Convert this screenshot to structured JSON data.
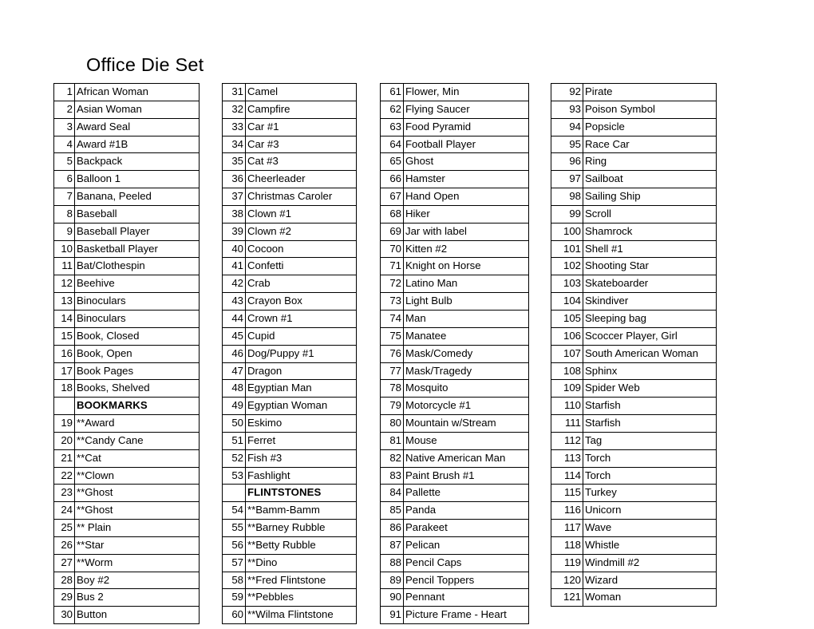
{
  "document": {
    "title": "Office Die Set"
  },
  "columns": [
    {
      "id": "column-1",
      "rows": [
        {
          "num": "1",
          "label": "African Woman",
          "section": false
        },
        {
          "num": "2",
          "label": "Asian Woman",
          "section": false
        },
        {
          "num": "3",
          "label": "Award Seal",
          "section": false
        },
        {
          "num": "4",
          "label": "Award #1B",
          "section": false
        },
        {
          "num": "5",
          "label": "Backpack",
          "section": false
        },
        {
          "num": "6",
          "label": "Balloon 1",
          "section": false
        },
        {
          "num": "7",
          "label": "Banana, Peeled",
          "section": false
        },
        {
          "num": "8",
          "label": "Baseball",
          "section": false
        },
        {
          "num": "9",
          "label": "Baseball Player",
          "section": false
        },
        {
          "num": "10",
          "label": "Basketball Player",
          "section": false
        },
        {
          "num": "11",
          "label": "Bat/Clothespin",
          "section": false
        },
        {
          "num": "12",
          "label": "Beehive",
          "section": false
        },
        {
          "num": "13",
          "label": "Binoculars",
          "section": false
        },
        {
          "num": "14",
          "label": "Binoculars",
          "section": false
        },
        {
          "num": "15",
          "label": "Book, Closed",
          "section": false
        },
        {
          "num": "16",
          "label": "Book, Open",
          "section": false
        },
        {
          "num": "17",
          "label": "Book Pages",
          "section": false
        },
        {
          "num": "18",
          "label": "Books, Shelved",
          "section": false
        },
        {
          "num": "",
          "label": "BOOKMARKS",
          "section": true
        },
        {
          "num": "19",
          "label": "**Award",
          "section": false
        },
        {
          "num": "20",
          "label": "**Candy Cane",
          "section": false
        },
        {
          "num": "21",
          "label": "**Cat",
          "section": false
        },
        {
          "num": "22",
          "label": "**Clown",
          "section": false
        },
        {
          "num": "23",
          "label": "**Ghost",
          "section": false
        },
        {
          "num": "24",
          "label": "**Ghost",
          "section": false
        },
        {
          "num": "25",
          "label": "** Plain",
          "section": false
        },
        {
          "num": "26",
          "label": "**Star",
          "section": false
        },
        {
          "num": "27",
          "label": "**Worm",
          "section": false
        },
        {
          "num": "28",
          "label": "Boy #2",
          "section": false
        },
        {
          "num": "29",
          "label": "Bus 2",
          "section": false
        },
        {
          "num": "30",
          "label": "Button",
          "section": false
        }
      ]
    },
    {
      "id": "column-2",
      "rows": [
        {
          "num": "31",
          "label": "Camel",
          "section": false
        },
        {
          "num": "32",
          "label": "Campfire",
          "section": false
        },
        {
          "num": "33",
          "label": "Car #1",
          "section": false
        },
        {
          "num": "34",
          "label": "Car #3",
          "section": false
        },
        {
          "num": "35",
          "label": "Cat #3",
          "section": false
        },
        {
          "num": "36",
          "label": "Cheerleader",
          "section": false
        },
        {
          "num": "37",
          "label": "Christmas Caroler",
          "section": false
        },
        {
          "num": "38",
          "label": "Clown #1",
          "section": false
        },
        {
          "num": "39",
          "label": "Clown #2",
          "section": false
        },
        {
          "num": "40",
          "label": "Cocoon",
          "section": false
        },
        {
          "num": "41",
          "label": "Confetti",
          "section": false
        },
        {
          "num": "42",
          "label": "Crab",
          "section": false
        },
        {
          "num": "43",
          "label": "Crayon Box",
          "section": false
        },
        {
          "num": "44",
          "label": "Crown #1",
          "section": false
        },
        {
          "num": "45",
          "label": "Cupid",
          "section": false
        },
        {
          "num": "46",
          "label": "Dog/Puppy #1",
          "section": false
        },
        {
          "num": "47",
          "label": "Dragon",
          "section": false
        },
        {
          "num": "48",
          "label": "Egyptian Man",
          "section": false
        },
        {
          "num": "49",
          "label": "Egyptian Woman",
          "section": false
        },
        {
          "num": "50",
          "label": "Eskimo",
          "section": false
        },
        {
          "num": "51",
          "label": "Ferret",
          "section": false
        },
        {
          "num": "52",
          "label": "Fish #3",
          "section": false
        },
        {
          "num": "53",
          "label": "Fashlight",
          "section": false
        },
        {
          "num": "",
          "label": "FLINTSTONES",
          "section": true
        },
        {
          "num": "54",
          "label": "**Bamm-Bamm",
          "section": false
        },
        {
          "num": "55",
          "label": "**Barney Rubble",
          "section": false
        },
        {
          "num": "56",
          "label": "**Betty Rubble",
          "section": false
        },
        {
          "num": "57",
          "label": "**Dino",
          "section": false
        },
        {
          "num": "58",
          "label": "**Fred Flintstone",
          "section": false
        },
        {
          "num": "59",
          "label": "**Pebbles",
          "section": false
        },
        {
          "num": "60",
          "label": "**Wilma Flintstone",
          "section": false
        }
      ]
    },
    {
      "id": "column-3",
      "rows": [
        {
          "num": "61",
          "label": "Flower, Min",
          "section": false
        },
        {
          "num": "62",
          "label": "Flying Saucer",
          "section": false
        },
        {
          "num": "63",
          "label": "Food Pyramid",
          "section": false
        },
        {
          "num": "64",
          "label": "Football Player",
          "section": false
        },
        {
          "num": "65",
          "label": "Ghost",
          "section": false
        },
        {
          "num": "66",
          "label": "Hamster",
          "section": false
        },
        {
          "num": "67",
          "label": "Hand Open",
          "section": false
        },
        {
          "num": "68",
          "label": "Hiker",
          "section": false
        },
        {
          "num": "69",
          "label": "Jar with label",
          "section": false
        },
        {
          "num": "70",
          "label": "Kitten #2",
          "section": false
        },
        {
          "num": "71",
          "label": "Knight on Horse",
          "section": false
        },
        {
          "num": "72",
          "label": "Latino Man",
          "section": false
        },
        {
          "num": "73",
          "label": "Light Bulb",
          "section": false
        },
        {
          "num": "74",
          "label": "Man",
          "section": false
        },
        {
          "num": "75",
          "label": "Manatee",
          "section": false
        },
        {
          "num": "76",
          "label": "Mask/Comedy",
          "section": false
        },
        {
          "num": "77",
          "label": "Mask/Tragedy",
          "section": false
        },
        {
          "num": "78",
          "label": "Mosquito",
          "section": false
        },
        {
          "num": "79",
          "label": "Motorcycle #1",
          "section": false
        },
        {
          "num": "80",
          "label": "Mountain w/Stream",
          "section": false
        },
        {
          "num": "81",
          "label": "Mouse",
          "section": false
        },
        {
          "num": "82",
          "label": "Native American Man",
          "section": false
        },
        {
          "num": "83",
          "label": "Paint Brush #1",
          "section": false
        },
        {
          "num": "84",
          "label": "Pallette",
          "section": false
        },
        {
          "num": "85",
          "label": "Panda",
          "section": false
        },
        {
          "num": "86",
          "label": "Parakeet",
          "section": false
        },
        {
          "num": "87",
          "label": "Pelican",
          "section": false
        },
        {
          "num": "88",
          "label": "Pencil Caps",
          "section": false
        },
        {
          "num": "89",
          "label": "Pencil Toppers",
          "section": false
        },
        {
          "num": "90",
          "label": "Pennant",
          "section": false
        },
        {
          "num": "91",
          "label": "Picture Frame - Heart",
          "section": false
        }
      ]
    },
    {
      "id": "column-4",
      "rows": [
        {
          "num": "92",
          "label": "Pirate",
          "section": false
        },
        {
          "num": "93",
          "label": "Poison Symbol",
          "section": false
        },
        {
          "num": "94",
          "label": "Popsicle",
          "section": false
        },
        {
          "num": "95",
          "label": "Race Car",
          "section": false
        },
        {
          "num": "96",
          "label": "Ring",
          "section": false
        },
        {
          "num": "97",
          "label": "Sailboat",
          "section": false
        },
        {
          "num": "98",
          "label": "Sailing Ship",
          "section": false
        },
        {
          "num": "99",
          "label": "Scroll",
          "section": false
        },
        {
          "num": "100",
          "label": "Shamrock",
          "section": false
        },
        {
          "num": "101",
          "label": "Shell #1",
          "section": false
        },
        {
          "num": "102",
          "label": "Shooting Star",
          "section": false
        },
        {
          "num": "103",
          "label": "Skateboarder",
          "section": false
        },
        {
          "num": "104",
          "label": "Skindiver",
          "section": false
        },
        {
          "num": "105",
          "label": "Sleeping bag",
          "section": false
        },
        {
          "num": "106",
          "label": "Scoccer Player, Girl",
          "section": false
        },
        {
          "num": "107",
          "label": "South American Woman",
          "section": false
        },
        {
          "num": "108",
          "label": "Sphinx",
          "section": false
        },
        {
          "num": "109",
          "label": "Spider Web",
          "section": false
        },
        {
          "num": "110",
          "label": "Starfish",
          "section": false
        },
        {
          "num": "111",
          "label": "Starfish",
          "section": false
        },
        {
          "num": "112",
          "label": "Tag",
          "section": false
        },
        {
          "num": "113",
          "label": "Torch",
          "section": false
        },
        {
          "num": "114",
          "label": "Torch",
          "section": false
        },
        {
          "num": "115",
          "label": "Turkey",
          "section": false
        },
        {
          "num": "116",
          "label": "Unicorn",
          "section": false
        },
        {
          "num": "117",
          "label": "Wave",
          "section": false
        },
        {
          "num": "118",
          "label": "Whistle",
          "section": false
        },
        {
          "num": "119",
          "label": "Windmill #2",
          "section": false
        },
        {
          "num": "120",
          "label": "Wizard",
          "section": false
        },
        {
          "num": "121",
          "label": "Woman",
          "section": false
        }
      ]
    }
  ]
}
